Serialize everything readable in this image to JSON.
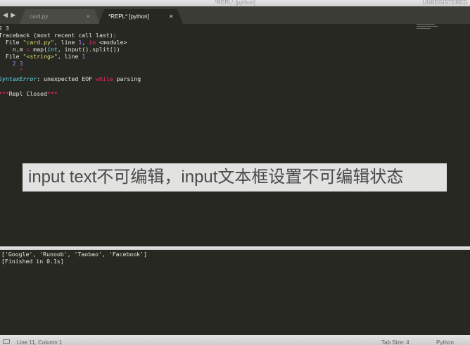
{
  "window": {
    "title": "*REPL* [python]",
    "registration": "UNREGISTERED"
  },
  "tabs": [
    {
      "label": "card.py",
      "close": "×",
      "active": false
    },
    {
      "label": "*REPL* [python]",
      "close": "×",
      "active": true
    }
  ],
  "nav": {
    "arrows": "◀ ▶"
  },
  "editor": {
    "lines": {
      "l1": "2 3",
      "l2": "Traceback (most recent call last):",
      "l3a": "  File ",
      "l3b": "\"card.py\"",
      "l3c": ", line ",
      "l3d": "1",
      "l3e": ", ",
      "l3f": "in",
      "l3g": " <",
      "l3h": "module",
      "l3i": ">",
      "l4a": "    n,m ",
      "l4b": "=",
      "l4c": " map(",
      "l4d": "int",
      "l4e": ", input().split())",
      "l5a": "  File ",
      "l5b": "\"<string>\"",
      "l5c": ", line ",
      "l5d": "1",
      "l6": "    2 3",
      "l7": "      ^",
      "l8a": "SyntaxError",
      "l8b": ": unexpected EOF ",
      "l8c": "while",
      "l8d": " parsing",
      "l9a": "***",
      "l9b": "Repl Closed",
      "l9c": "***"
    }
  },
  "banner": {
    "text": "input text不可编辑，input文本框设置不可编辑状态"
  },
  "output": {
    "line1": "['Google', 'Runoob', 'Taobao', 'Facebook']",
    "line2": "[Finished in 0.1s]"
  },
  "statusbar": {
    "position": "Line 11, Column 1",
    "tab_size": "Tab Size: 4",
    "syntax": "Python"
  },
  "colors": {
    "background": "#272822",
    "keyword": "#f92672",
    "string": "#e6db74",
    "number": "#ae81ff",
    "builtin": "#66d9ef"
  }
}
